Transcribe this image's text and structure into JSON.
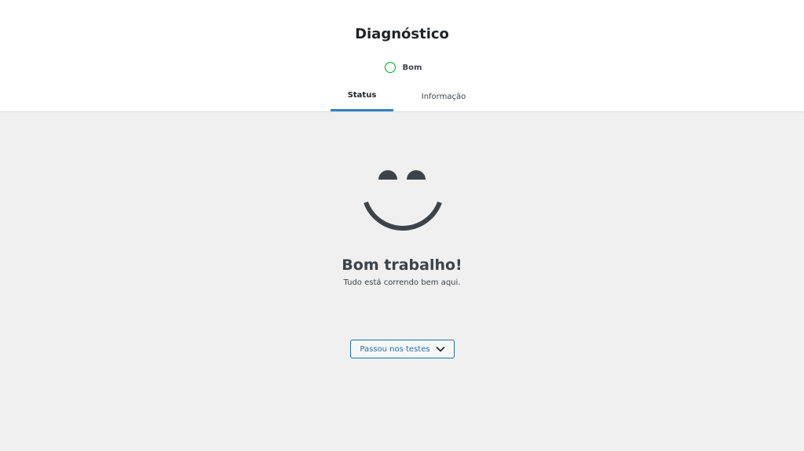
{
  "header": {
    "title": "Diagnóstico",
    "status": {
      "label": "Bom",
      "color": "#00a32a"
    },
    "tabs": [
      {
        "label": "Status",
        "active": true
      },
      {
        "label": "Informação",
        "active": false
      }
    ]
  },
  "main": {
    "illustration": "smiley-face-icon",
    "title": "Bom trabalho!",
    "subtitle": "Tudo está correndo bem aqui.",
    "passed_tests_button": {
      "label": "Passou nos testes",
      "icon": "chevron-down-icon"
    }
  },
  "colors": {
    "accent": "#2271b1",
    "tab_underline": "#3582c4",
    "good": "#00a32a",
    "text": "#1d2327",
    "background": "#f0f0f1"
  }
}
